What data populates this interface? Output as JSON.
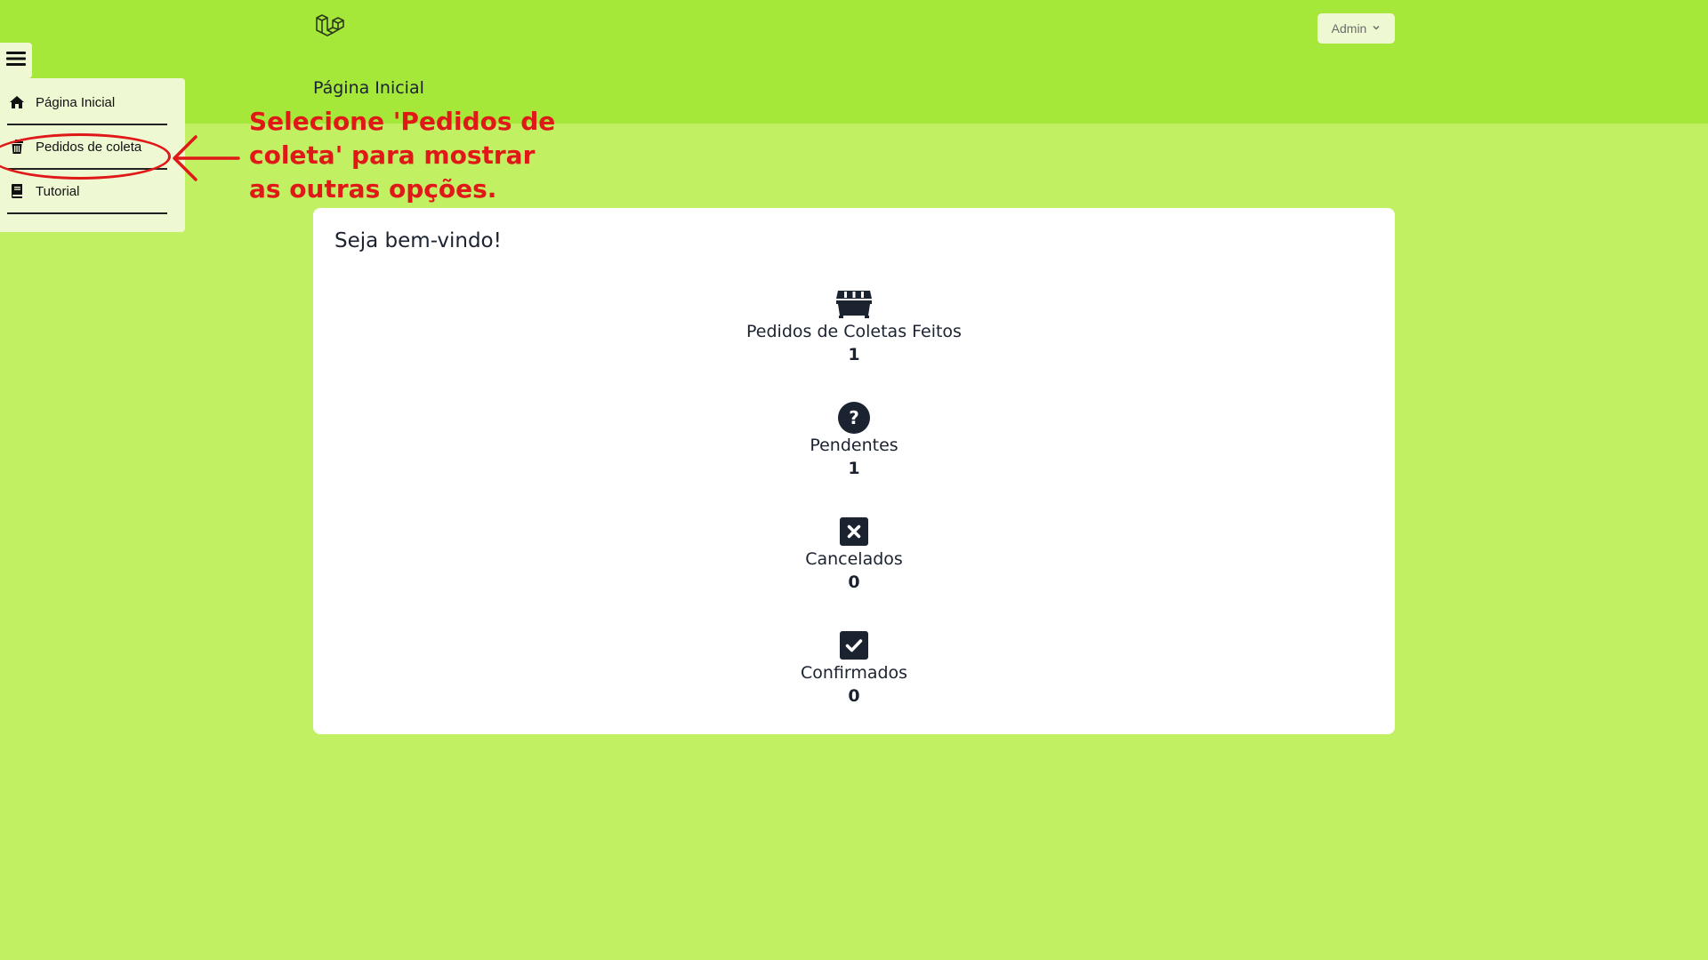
{
  "header": {
    "page_title": "Página Inicial",
    "user_menu_label": "Admin",
    "logo_icon": "laravel-logo-icon"
  },
  "sidebar": {
    "toggle_icon": "hamburger-icon",
    "items": [
      {
        "label": "Página Inicial",
        "icon": "home-icon"
      },
      {
        "label": "Pedidos de coleta",
        "icon": "trash-icon"
      },
      {
        "label": "Tutorial",
        "icon": "book-icon"
      }
    ]
  },
  "annotation": {
    "text": "Selecione 'Pedidos de coleta' para mostrar as outras opções.",
    "color": "#e01818"
  },
  "dashboard": {
    "title": "Seja bem-vindo!",
    "stats": [
      {
        "label": "Pedidos de Coletas Feitos",
        "value": "1",
        "icon": "dumpster-icon"
      },
      {
        "label": "Pendentes",
        "value": "1",
        "icon": "question-circle-icon"
      },
      {
        "label": "Cancelados",
        "value": "0",
        "icon": "x-square-icon"
      },
      {
        "label": "Confirmados",
        "value": "0",
        "icon": "check-square-icon"
      }
    ]
  },
  "colors": {
    "page_background": "#c2f063",
    "header_background": "#a5e83a",
    "menu_background": "#eef9d3",
    "icon_dark": "#1b2230"
  }
}
